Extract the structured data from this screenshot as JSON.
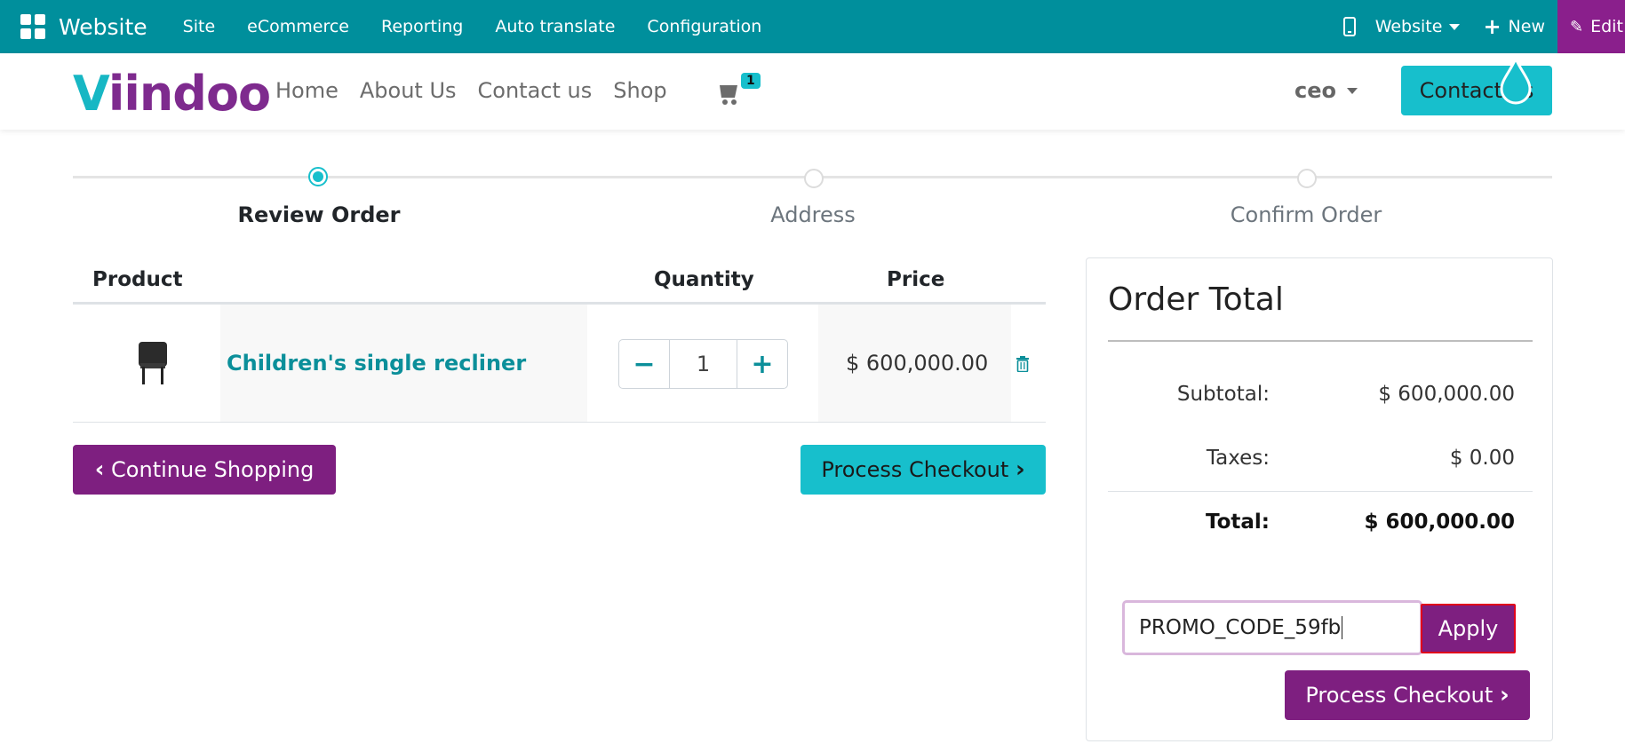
{
  "topbar": {
    "brand": "Website",
    "menus": [
      "Site",
      "eCommerce",
      "Reporting",
      "Auto translate",
      "Configuration"
    ],
    "website_dropdown": "Website",
    "new_label": "New",
    "edit_label": "Edit"
  },
  "header": {
    "logo_v": "V",
    "logo_rest": "iindoo",
    "nav": [
      "Home",
      "About Us",
      "Contact us",
      "Shop"
    ],
    "cart_count": "1",
    "user": "ceo",
    "contact_button": "Contact us"
  },
  "steps": [
    {
      "label": "Review Order",
      "active": true
    },
    {
      "label": "Address",
      "active": false
    },
    {
      "label": "Confirm Order",
      "active": false
    }
  ],
  "table": {
    "headers": {
      "product": "Product",
      "quantity": "Quantity",
      "price": "Price"
    },
    "rows": [
      {
        "name": "Children's single recliner",
        "quantity": "1",
        "price": "$ 600,000.00"
      }
    ]
  },
  "actions": {
    "continue_shopping": "Continue Shopping",
    "process_checkout": "Process Checkout"
  },
  "order_total": {
    "title": "Order Total",
    "subtotal_label": "Subtotal:",
    "subtotal_value": "$ 600,000.00",
    "taxes_label": "Taxes:",
    "taxes_value": "$ 0.00",
    "total_label": "Total:",
    "total_value": "$ 600,000.00",
    "promo_value": "PROMO_CODE_59fb",
    "apply_label": "Apply",
    "process_checkout": "Process Checkout"
  },
  "colors": {
    "topbar": "#008f9c",
    "accent_teal": "#17bfcc",
    "accent_purple": "#7e1f80"
  }
}
